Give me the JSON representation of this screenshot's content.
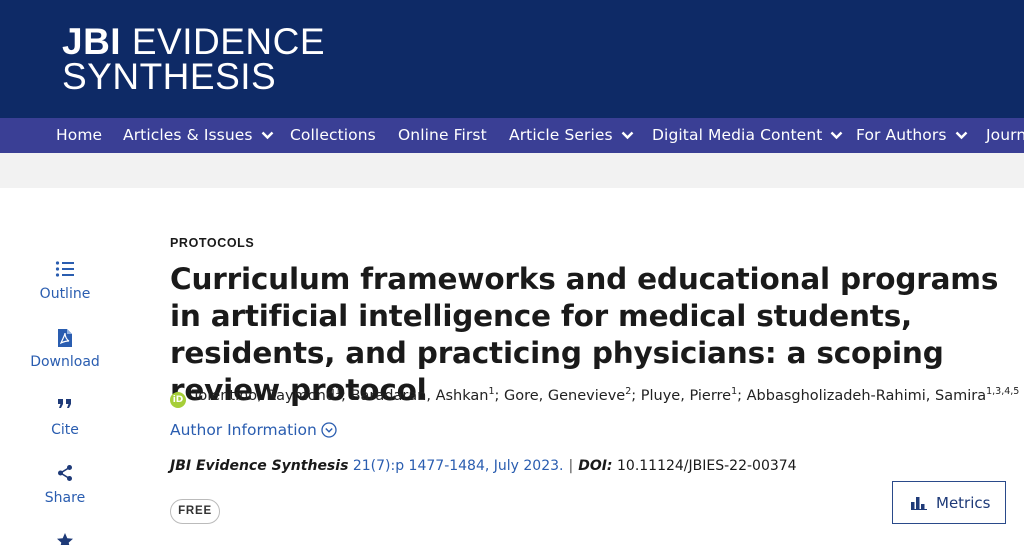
{
  "brand": {
    "line1_bold": "JBI",
    "line1_rest": "EVIDENCE",
    "line2": "SYNTHESIS"
  },
  "nav": {
    "items": [
      {
        "label": "Home",
        "has_dropdown": false
      },
      {
        "label": "Articles & Issues",
        "has_dropdown": true
      },
      {
        "label": "Collections",
        "has_dropdown": false
      },
      {
        "label": "Online First",
        "has_dropdown": false
      },
      {
        "label": "Article Series",
        "has_dropdown": true
      },
      {
        "label": "Digital Media Content",
        "has_dropdown": true
      },
      {
        "label": "For Authors",
        "has_dropdown": true
      },
      {
        "label": "Journ",
        "has_dropdown": false
      }
    ]
  },
  "rail": {
    "items": [
      {
        "label": "Outline",
        "icon": "outline-icon"
      },
      {
        "label": "Download",
        "icon": "pdf-icon"
      },
      {
        "label": "Cite",
        "icon": "quote-icon"
      },
      {
        "label": "Share",
        "icon": "share-icon"
      },
      {
        "label": "",
        "icon": "star-icon"
      }
    ]
  },
  "article": {
    "section": "PROTOCOLS",
    "title": "Curriculum frameworks and educational programs in artificial intelligence for medical students, residents, and practicing physicians: a scoping review protocol",
    "orcid_badge": "iD",
    "authors": [
      {
        "name": "Tolentino, Raymond",
        "aff": "1"
      },
      {
        "name": "Baradaran, Ashkan",
        "aff": "1"
      },
      {
        "name": "Gore, Genevieve",
        "aff": "2"
      },
      {
        "name": "Pluye, Pierre",
        "aff": "1"
      },
      {
        "name": "Abbasgholizadeh-Rahimi, Samira",
        "aff": "1,3,4,5"
      }
    ],
    "author_info_label": "Author Information",
    "journal": "JBI Evidence Synthesis",
    "citation": "21(7):p 1477-1484, July 2023.",
    "separator": "|",
    "doi_label": "DOI:",
    "doi": "10.11124/JBIES-22-00374",
    "access_badge": "FREE"
  },
  "metrics_button": {
    "label": "Metrics"
  },
  "colors": {
    "masthead": "#0e2a66",
    "nav": "#3a3f95",
    "link": "#2a5db0",
    "orcid": "#a6ce39"
  }
}
